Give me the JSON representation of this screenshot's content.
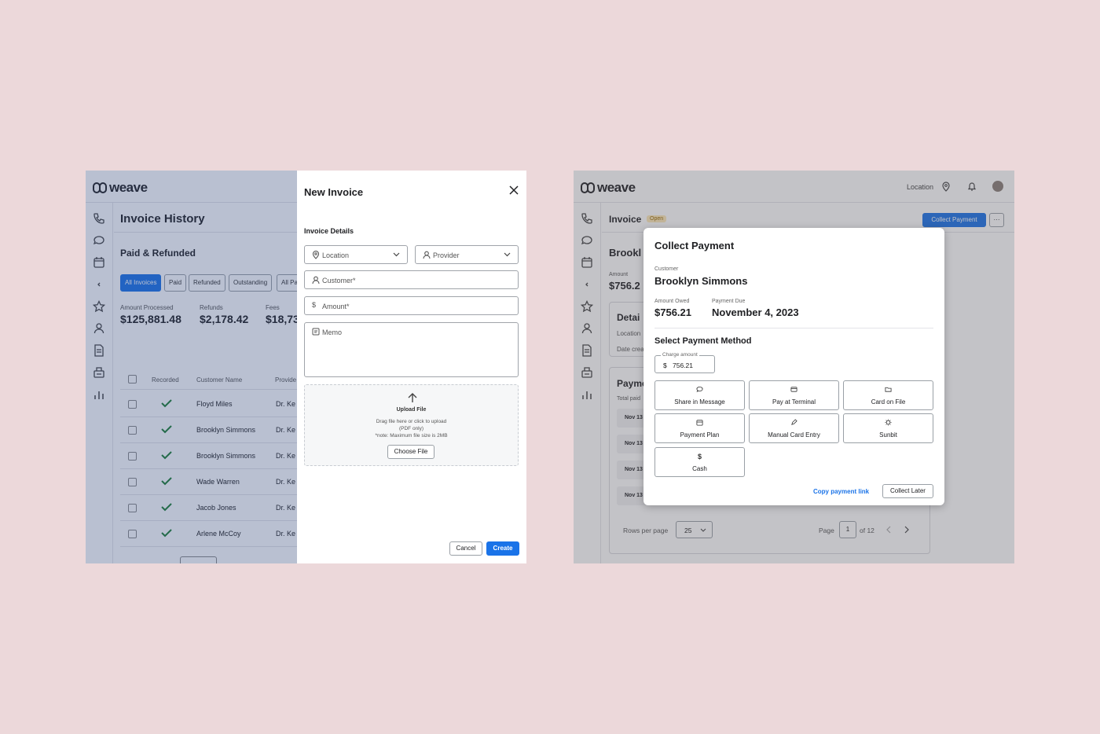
{
  "left_screen": {
    "brand": "weave",
    "page_title": "Invoice History",
    "section_title": "Paid & Refunded",
    "filters": [
      "All Invoices",
      "Paid",
      "Refunded",
      "Outstanding",
      "All Pa"
    ],
    "stats": [
      {
        "label": "Amount Processed",
        "value": "$125,881.48"
      },
      {
        "label": "Refunds",
        "value": "$2,178.42"
      },
      {
        "label": "Fees",
        "value": "$18,73"
      }
    ],
    "table_headers": [
      "Recorded",
      "Customer Name",
      "Provide"
    ],
    "rows": [
      {
        "customer": "Floyd Miles",
        "provider": "Dr. Ke"
      },
      {
        "customer": "Brooklyn Simmons",
        "provider": "Dr. Ke"
      },
      {
        "customer": "Brooklyn Simmons",
        "provider": "Dr. Ke"
      },
      {
        "customer": "Wade Warren",
        "provider": "Dr. Ke"
      },
      {
        "customer": "Jacob Jones",
        "provider": "Dr. Ke"
      },
      {
        "customer": "Arlene McCoy",
        "provider": "Dr. Ke"
      }
    ],
    "drawer": {
      "title": "New Invoice",
      "section": "Invoice Details",
      "location_placeholder": "Location",
      "provider_placeholder": "Provider",
      "customer_placeholder": "Customer*",
      "amount_placeholder": "Amount*",
      "memo_placeholder": "Memo",
      "upload_title": "Upload File",
      "upload_hint_1": "Drag file here or click to upload",
      "upload_hint_2": "(PDF only)",
      "upload_hint_3": "*note: Maximum file size is 2MB",
      "choose_file": "Choose File",
      "cancel": "Cancel",
      "create": "Create"
    }
  },
  "right_screen": {
    "brand": "weave",
    "location_label": "Location",
    "page_title": "Invoice",
    "status_badge": "Open",
    "collect_payment": "Collect Payment",
    "more": "···",
    "bg_customer": "Brookl",
    "bg_amount_label": "Amount",
    "bg_amount": "$756.2",
    "bg_details": "Detai",
    "bg_location": "Location",
    "bg_date": "Date crea",
    "bg_payments": "Payme",
    "bg_total": "Total paid",
    "bg_dates": [
      "Nov 13",
      "Nov 13",
      "Nov 13",
      "Nov 13"
    ],
    "rows_per_page_label": "Rows per page",
    "rows_per_page": "25",
    "page_label": "Page",
    "page_num": "1",
    "page_of": "of 12",
    "modal": {
      "title": "Collect Payment",
      "customer_label": "Customer",
      "customer": "Brooklyn Simmons",
      "amount_owed_label": "Amount Owed",
      "amount_owed": "$756.21",
      "payment_due_label": "Payment Due",
      "payment_due": "November 4, 2023",
      "select_method": "Select Payment Method",
      "charge_label": "Charge amount",
      "currency": "$",
      "charge_amount": "756.21",
      "methods": [
        {
          "label": "Share in Message",
          "icon": "message-icon"
        },
        {
          "label": "Pay at Terminal",
          "icon": "terminal-icon"
        },
        {
          "label": "Card on File",
          "icon": "folder-icon"
        },
        {
          "label": "Payment Plan",
          "icon": "calendar-icon"
        },
        {
          "label": "Manual Card Entry",
          "icon": "pencil-icon"
        },
        {
          "label": "Sunbit",
          "icon": "sunbit-icon"
        },
        {
          "label": "Cash",
          "icon": "dollar-icon"
        }
      ],
      "copy_link": "Copy payment link",
      "collect_later": "Collect Later"
    }
  },
  "colors": {
    "background": "#ecd8da",
    "accent": "#1a73e8",
    "success": "#1e7e34",
    "link": "#1a73e8"
  }
}
